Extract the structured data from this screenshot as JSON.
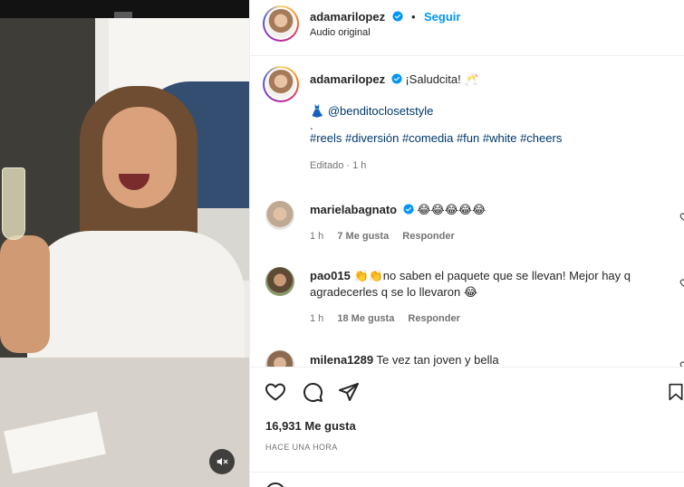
{
  "post": {
    "username": "adamarilopez",
    "follow_label": "Seguir",
    "audio_label": "Audio original",
    "caption_text": "¡Saludcita! 🥂",
    "caption_dress_emoji": "👗",
    "caption_mention": "@benditoclosetstyle",
    "caption_dot": ".",
    "caption_hashtags": [
      "#reels",
      "#diversión",
      "#comedia",
      "#fun",
      "#white",
      "#cheers"
    ],
    "caption_meta": "Editado · 1 h"
  },
  "comments": [
    {
      "username": "marielabagnato",
      "verified": true,
      "text": "😂😂😂😂😂",
      "time": "1 h",
      "likes": "7 Me gusta",
      "reply": "Responder"
    },
    {
      "username": "pao015",
      "verified": false,
      "text": "👏👏no saben el paquete que se llevan! Mejor hay q agradecerles q se lo llevaron 😂",
      "time": "1 h",
      "likes": "18 Me gusta",
      "reply": "Responder"
    },
    {
      "username": "milena1289",
      "verified": false,
      "text": "Te vez tan joven y bella"
    }
  ],
  "actions": {
    "likes_count": "16,931 Me gusta",
    "time_ago": "HACE UNA HORA"
  },
  "icons": {
    "verified": "verified-badge-icon",
    "like": "heart-icon",
    "comment": "comment-icon",
    "share": "share-icon",
    "save": "bookmark-icon",
    "mute": "speaker-muted-icon"
  },
  "colors": {
    "link": "#0095f6",
    "mention": "#00376b",
    "verified": "#0095f6",
    "meta": "#737373"
  }
}
